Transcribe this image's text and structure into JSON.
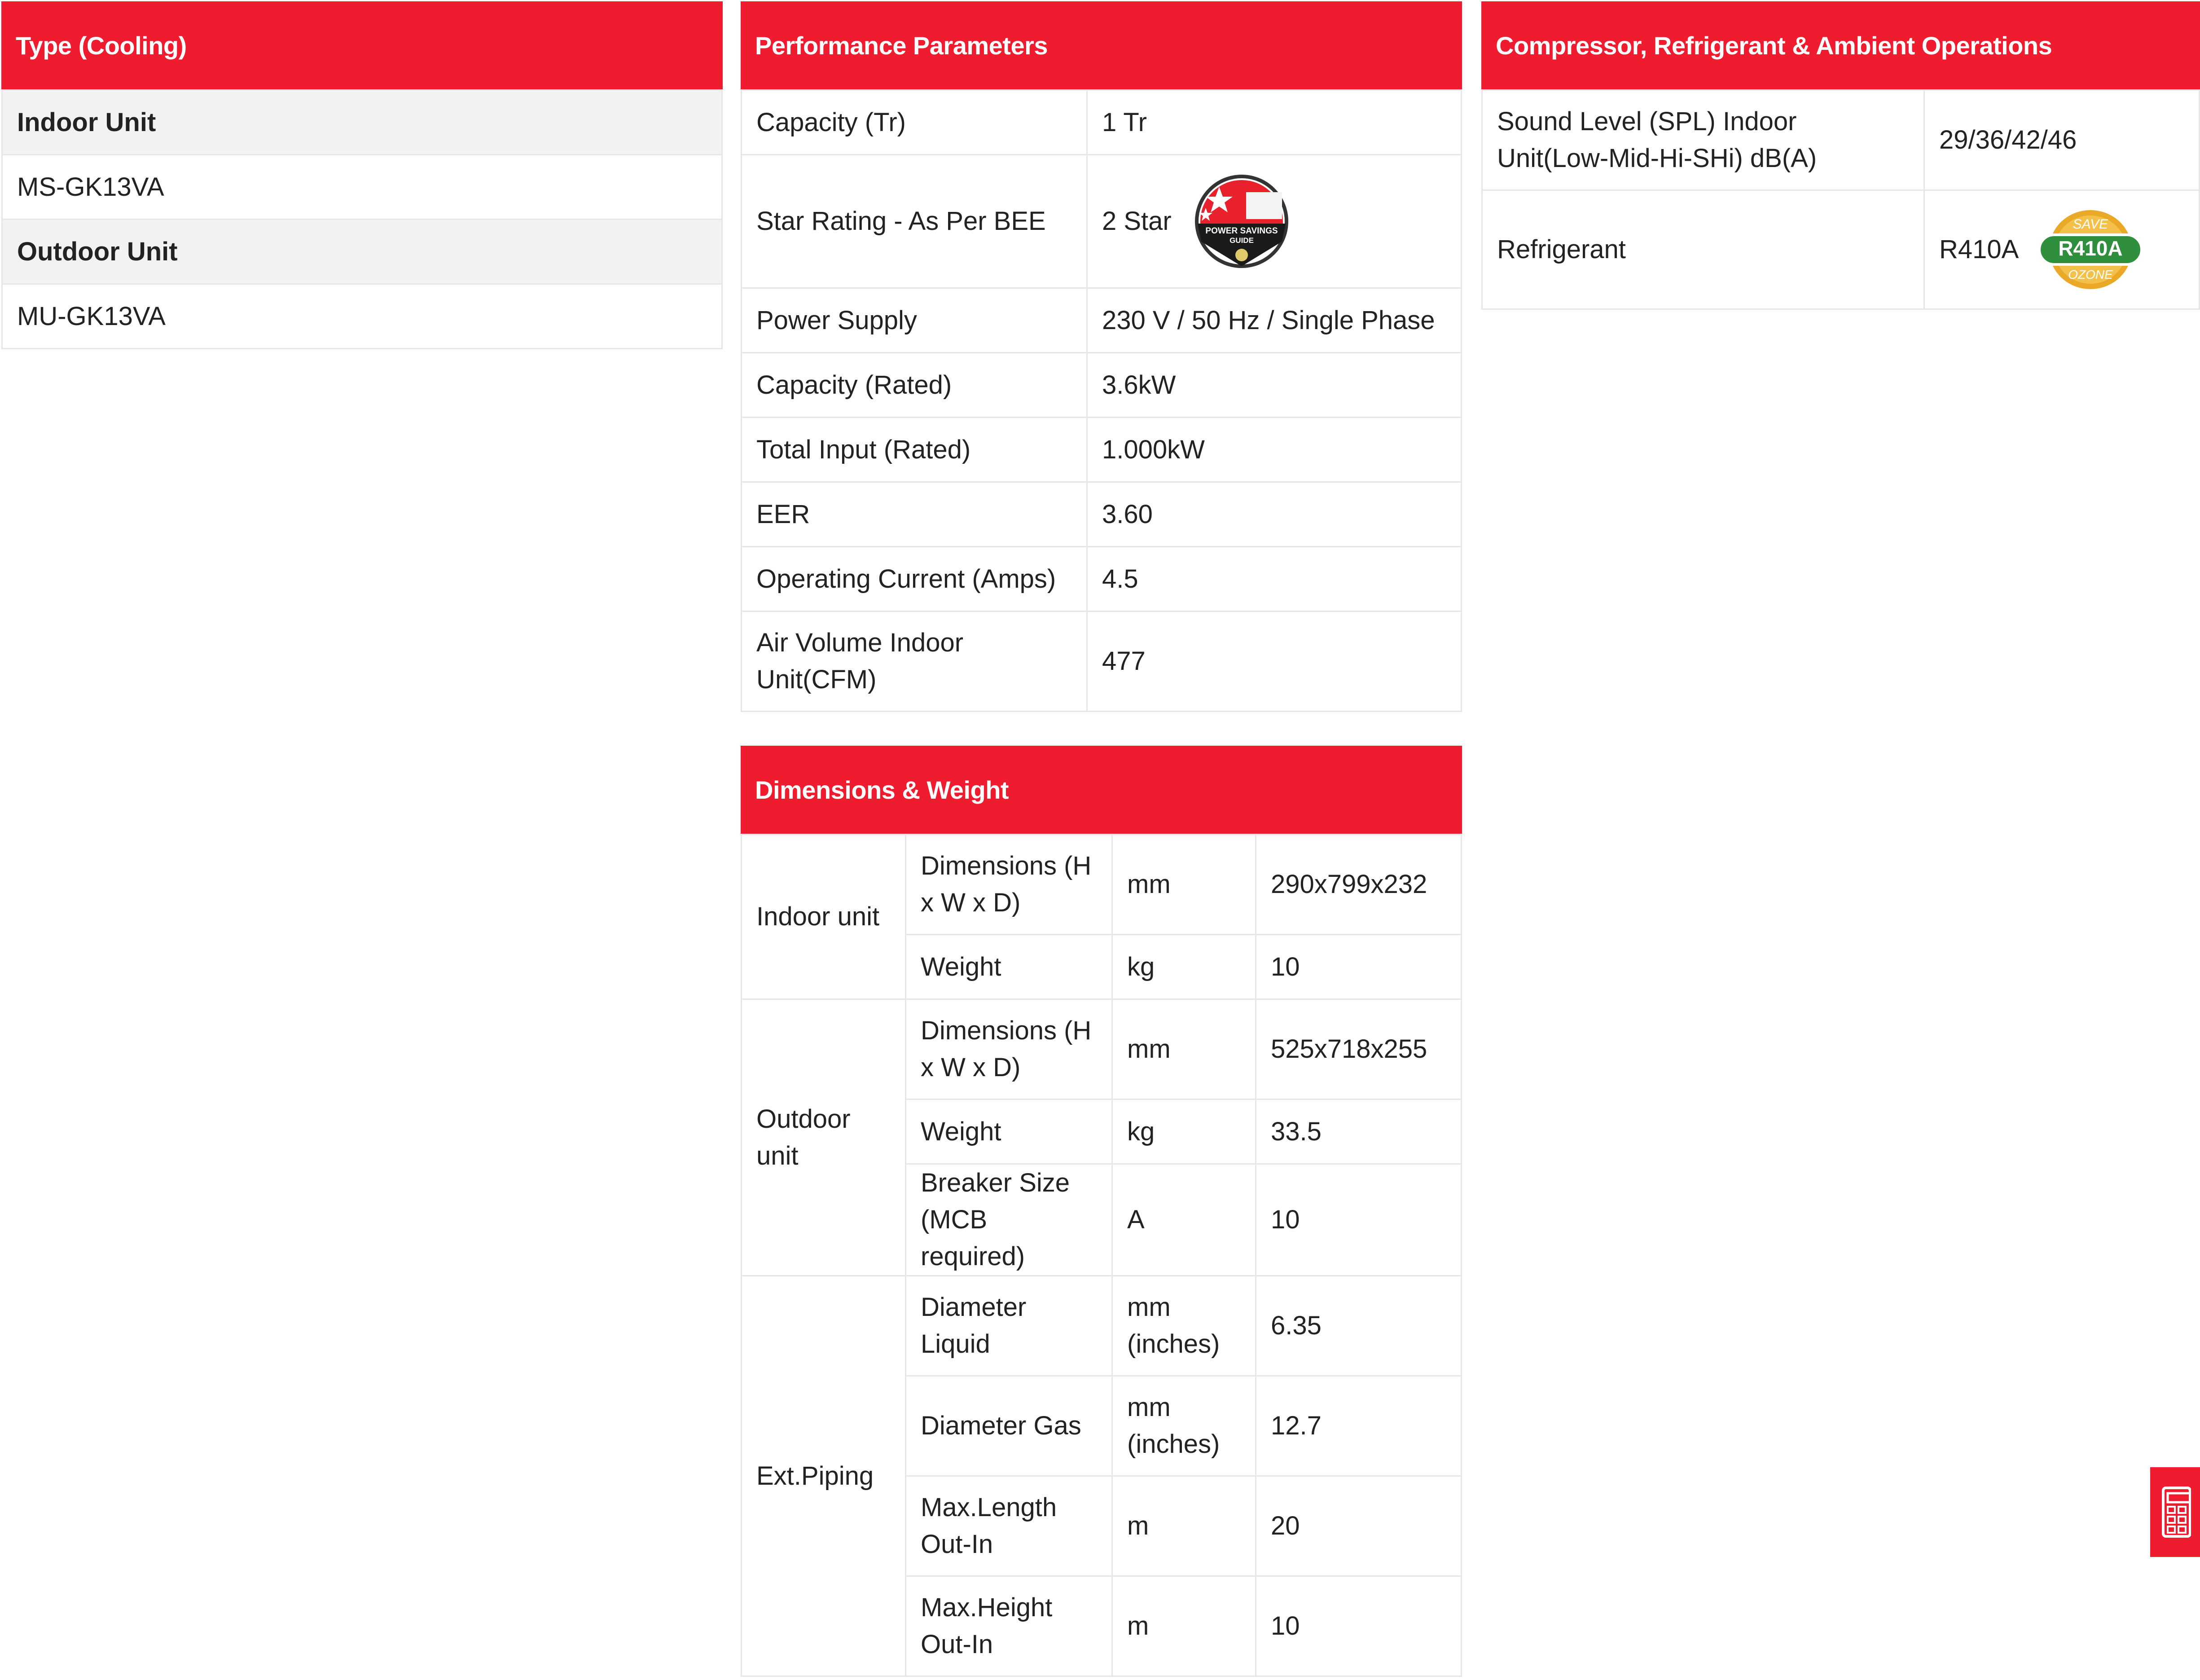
{
  "type_panel": {
    "header": "Type (Cooling)",
    "rows": [
      {
        "text": "Indoor Unit",
        "kind": "heading"
      },
      {
        "text": "MS-GK13VA",
        "kind": "value"
      },
      {
        "text": "Outdoor Unit",
        "kind": "heading"
      },
      {
        "text": "MU-GK13VA",
        "kind": "value"
      }
    ]
  },
  "performance": {
    "header": "Performance Parameters",
    "rows": [
      {
        "label": "Capacity (Tr)",
        "value": "1 Tr"
      },
      {
        "label": "Star Rating - As Per BEE",
        "value": "2 Star",
        "badge": "bee-power-savings-guide-icon"
      },
      {
        "label": "Power Supply",
        "value": "230 V / 50 Hz / Single Phase"
      },
      {
        "label": "Capacity (Rated)",
        "value": "3.6kW"
      },
      {
        "label": "Total Input (Rated)",
        "value": "1.000kW"
      },
      {
        "label": "EER",
        "value": "3.60"
      },
      {
        "label": "Operating Current (Amps)",
        "value": "4.5"
      },
      {
        "label": "Air Volume Indoor Unit(CFM)",
        "value": "477"
      }
    ],
    "bee_badge_text": {
      "line1": "POWER SAVINGS",
      "line2": "GUIDE"
    }
  },
  "compressor": {
    "header": "Compressor, Refrigerant & Ambient Operations",
    "rows": [
      {
        "label": "Sound Level (SPL) Indoor Unit(Low-Mid-Hi-SHi) dB(A)",
        "value": "29/36/42/46"
      },
      {
        "label": "Refrigerant",
        "value": "R410A",
        "badge": "save-ozone-r410a-icon"
      }
    ],
    "ozone_badge_text": {
      "top": "SAVE",
      "middle": "R410A",
      "bottom": "OZONE"
    }
  },
  "dimensions": {
    "header": "Dimensions & Weight",
    "groups": [
      {
        "group": "Indoor unit",
        "rows": [
          {
            "label": "Dimensions (H x W x D)",
            "unit": "mm",
            "value": "290x799x232"
          },
          {
            "label": "Weight",
            "unit": "kg",
            "value": "10"
          }
        ]
      },
      {
        "group": "Outdoor unit",
        "rows": [
          {
            "label": "Dimensions (H x W x D)",
            "unit": "mm",
            "value": "525x718x255"
          },
          {
            "label": "Weight",
            "unit": "kg",
            "value": "33.5"
          },
          {
            "label": "Breaker Size (MCB required)",
            "unit": "A",
            "value": "10"
          }
        ]
      },
      {
        "group": "Ext.Piping",
        "rows": [
          {
            "label": "Diameter Liquid",
            "unit": "mm (inches)",
            "value": "6.35"
          },
          {
            "label": "Diameter Gas",
            "unit": "mm (inches)",
            "value": "12.7"
          },
          {
            "label": "Max.Length Out-In",
            "unit": "m",
            "value": "20"
          },
          {
            "label": "Max.Height Out-In",
            "unit": "m",
            "value": "10"
          }
        ]
      }
    ]
  },
  "floating_button": {
    "icon": "calculator-icon",
    "color": "#ee1c2e"
  },
  "colors": {
    "header_bg": "#ee1c2e",
    "border": "#e6e6e6",
    "heading_row_bg": "#f2f2f2"
  }
}
